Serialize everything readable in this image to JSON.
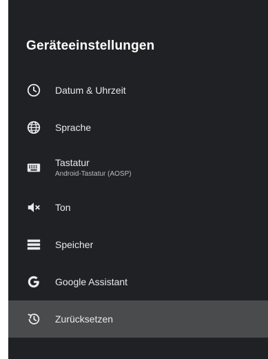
{
  "header": {
    "title": "Geräteeinstellungen"
  },
  "menu": {
    "items": [
      {
        "label": "Datum & Uhrzeit",
        "icon": "clock-icon"
      },
      {
        "label": "Sprache",
        "icon": "globe-icon"
      },
      {
        "label": "Tastatur",
        "sublabel": "Android-Tastatur (AOSP)",
        "icon": "keyboard-icon"
      },
      {
        "label": "Ton",
        "icon": "speaker-muted-icon"
      },
      {
        "label": "Speicher",
        "icon": "storage-icon"
      },
      {
        "label": "Google Assistant",
        "icon": "google-g-icon"
      },
      {
        "label": "Zurücksetzen",
        "icon": "restore-icon",
        "selected": true
      }
    ]
  },
  "colors": {
    "panel_background": "#202124",
    "selected_background": "#4a4b4d",
    "text_primary": "#e8eaed",
    "text_secondary": "#b9bbbe"
  }
}
